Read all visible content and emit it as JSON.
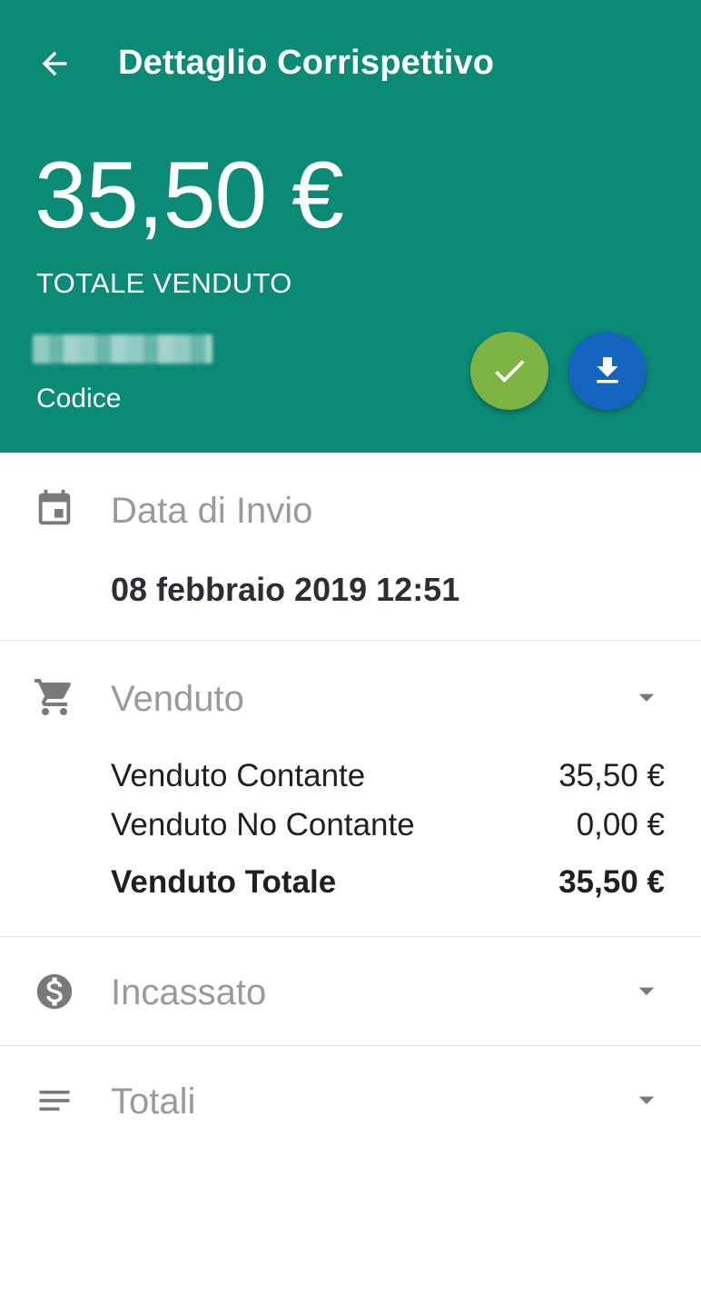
{
  "header": {
    "title": "Dettaglio Corrispettivo",
    "amount": "35,50 €",
    "amount_label": "TOTALE VENDUTO",
    "code_label": "Codice"
  },
  "sections": {
    "date": {
      "title": "Data di Invio",
      "value": "08 febbraio 2019 12:51",
      "icon": "calendar-icon"
    },
    "sold": {
      "title": "Venduto",
      "icon": "cart-icon",
      "rows": [
        {
          "label": "Venduto Contante",
          "value": "35,50 €"
        },
        {
          "label": "Venduto No Contante",
          "value": "0,00 €"
        },
        {
          "label": "Venduto Totale",
          "value": "35,50 €"
        }
      ]
    },
    "collected": {
      "title": "Incassato",
      "icon": "dollar-coin-icon"
    },
    "totals": {
      "title": "Totali",
      "icon": "notes-icon"
    }
  },
  "colors": {
    "header_bg": "#0b8a76",
    "check_fab": "#7cb342",
    "download_fab": "#1565c0",
    "muted_text": "#9a9a9a",
    "icon_gray": "#7a7a7a"
  }
}
